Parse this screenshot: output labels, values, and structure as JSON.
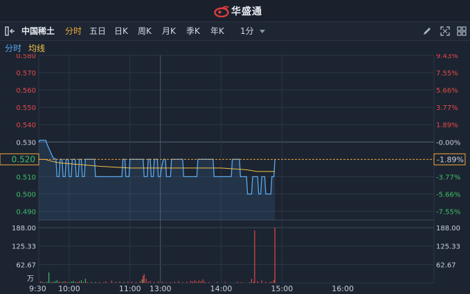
{
  "app": {
    "brand_name": "华盛通"
  },
  "toolbar": {
    "stock_name": "中国稀土",
    "tabs": [
      {
        "label": "分时",
        "active": true
      },
      {
        "label": "五日",
        "active": false
      },
      {
        "label": "日K",
        "active": false
      },
      {
        "label": "周K",
        "active": false
      },
      {
        "label": "月K",
        "active": false
      },
      {
        "label": "季K",
        "active": false
      },
      {
        "label": "年K",
        "active": false
      }
    ],
    "interval": "1分",
    "icons": [
      "collapse-icon",
      "pencil-icon",
      "fullscreen-icon",
      "grid-icon"
    ]
  },
  "legend": {
    "price_label": "分时",
    "avg_label": "均线"
  },
  "colors": {
    "background": "#1c2431",
    "grid": "#2c3646",
    "up": "#e54848",
    "down": "#3fbf6a",
    "price_line": "#5aa9f0",
    "avg_line": "#f2c44a",
    "neutral": "#c9d1dc"
  },
  "chart_data": {
    "type": "line",
    "prev_close": 0.53,
    "current_price_label": "0.520",
    "current_pct_label": "-1.89%",
    "price_ylim": [
      0.485,
      0.58
    ],
    "price_ticks_left": [
      "0.580",
      "0.570",
      "0.560",
      "0.550",
      "0.540",
      "0.530",
      "0.510",
      "0.500",
      "0.490"
    ],
    "price_ticks_right": [
      "9.43%",
      "7.55%",
      "5.66%",
      "3.77%",
      "1.89%",
      "-0.00%",
      "-3.77%",
      "-5.66%",
      "-7.55%"
    ],
    "volume_ylim": [
      0,
      188
    ],
    "volume_ticks_left": [
      "188.00",
      "125.33",
      "62.67"
    ],
    "volume_ticks_right": [
      "188.00",
      "125.33",
      "62.67"
    ],
    "volume_unit": "万",
    "time_labels": [
      "9:30",
      "10:00",
      "11:00",
      "13:00",
      "14:00",
      "15:00",
      "16:00"
    ],
    "session_minutes": 390,
    "price_series": [
      [
        0,
        0.53
      ],
      [
        1,
        0.531
      ],
      [
        7,
        0.531
      ],
      [
        8,
        0.529
      ],
      [
        14,
        0.521
      ],
      [
        17,
        0.52
      ],
      [
        18,
        0.51
      ],
      [
        20,
        0.51
      ],
      [
        21,
        0.52
      ],
      [
        23,
        0.52
      ],
      [
        24,
        0.51
      ],
      [
        26,
        0.51
      ],
      [
        27,
        0.52
      ],
      [
        29,
        0.52
      ],
      [
        30,
        0.51
      ],
      [
        32,
        0.51
      ],
      [
        33,
        0.52
      ],
      [
        36,
        0.52
      ],
      [
        37,
        0.51
      ],
      [
        39,
        0.51
      ],
      [
        40,
        0.52
      ],
      [
        42,
        0.52
      ],
      [
        43,
        0.51
      ],
      [
        45,
        0.51
      ],
      [
        46,
        0.52
      ],
      [
        55,
        0.52
      ],
      [
        56,
        0.51
      ],
      [
        82,
        0.51
      ],
      [
        83,
        0.52
      ],
      [
        85,
        0.52
      ],
      [
        86,
        0.51
      ],
      [
        89,
        0.51
      ],
      [
        90,
        0.52
      ],
      [
        103,
        0.52
      ],
      [
        104,
        0.51
      ],
      [
        107,
        0.51
      ],
      [
        108,
        0.52
      ],
      [
        110,
        0.52
      ],
      [
        111,
        0.51
      ],
      [
        113,
        0.51
      ],
      [
        114,
        0.52
      ],
      [
        117,
        0.52
      ],
      [
        118,
        0.51
      ],
      [
        120,
        0.51
      ],
      [
        121,
        0.515
      ],
      [
        123,
        0.52
      ],
      [
        125,
        0.52
      ],
      [
        126,
        0.51
      ],
      [
        130,
        0.51
      ],
      [
        131,
        0.52
      ],
      [
        142,
        0.52
      ],
      [
        143,
        0.51
      ],
      [
        156,
        0.51
      ],
      [
        157,
        0.52
      ],
      [
        172,
        0.52
      ],
      [
        173,
        0.51
      ],
      [
        190,
        0.51
      ],
      [
        191,
        0.52
      ],
      [
        198,
        0.52
      ],
      [
        199,
        0.51
      ],
      [
        205,
        0.51
      ],
      [
        206,
        0.5
      ],
      [
        210,
        0.5
      ],
      [
        211,
        0.51
      ],
      [
        216,
        0.51
      ],
      [
        217,
        0.5
      ],
      [
        219,
        0.5
      ],
      [
        220,
        0.51
      ],
      [
        223,
        0.51
      ],
      [
        224,
        0.5
      ],
      [
        229,
        0.5
      ],
      [
        230,
        0.51
      ],
      [
        232,
        0.51
      ],
      [
        233,
        0.52
      ]
    ],
    "avg_series": [
      [
        0,
        0.52
      ],
      [
        6,
        0.52
      ],
      [
        12,
        0.519
      ],
      [
        20,
        0.518
      ],
      [
        40,
        0.517
      ],
      [
        60,
        0.516
      ],
      [
        90,
        0.515
      ],
      [
        120,
        0.515
      ],
      [
        150,
        0.515
      ],
      [
        180,
        0.515
      ],
      [
        205,
        0.514
      ],
      [
        215,
        0.513
      ],
      [
        225,
        0.513
      ],
      [
        233,
        0.513
      ]
    ],
    "volume_series": [
      {
        "t": 2,
        "v": 6,
        "dir": "up"
      },
      {
        "t": 4,
        "v": 3,
        "dir": "down"
      },
      {
        "t": 6,
        "v": 2,
        "dir": "up"
      },
      {
        "t": 8,
        "v": 4,
        "dir": "down"
      },
      {
        "t": 10,
        "v": 36,
        "dir": "down"
      },
      {
        "t": 12,
        "v": 3,
        "dir": "down"
      },
      {
        "t": 14,
        "v": 4,
        "dir": "up"
      },
      {
        "t": 16,
        "v": 6,
        "dir": "down"
      },
      {
        "t": 18,
        "v": 9,
        "dir": "down"
      },
      {
        "t": 20,
        "v": 5,
        "dir": "up"
      },
      {
        "t": 22,
        "v": 3,
        "dir": "up"
      },
      {
        "t": 24,
        "v": 4,
        "dir": "down"
      },
      {
        "t": 26,
        "v": 6,
        "dir": "up"
      },
      {
        "t": 28,
        "v": 3,
        "dir": "up"
      },
      {
        "t": 30,
        "v": 2,
        "dir": "down"
      },
      {
        "t": 32,
        "v": 5,
        "dir": "down"
      },
      {
        "t": 34,
        "v": 7,
        "dir": "down"
      },
      {
        "t": 36,
        "v": 4,
        "dir": "up"
      },
      {
        "t": 38,
        "v": 3,
        "dir": "down"
      },
      {
        "t": 40,
        "v": 6,
        "dir": "up"
      },
      {
        "t": 42,
        "v": 9,
        "dir": "down"
      },
      {
        "t": 44,
        "v": 4,
        "dir": "up"
      },
      {
        "t": 46,
        "v": 14,
        "dir": "down"
      },
      {
        "t": 48,
        "v": 3,
        "dir": "up"
      },
      {
        "t": 52,
        "v": 4,
        "dir": "up"
      },
      {
        "t": 56,
        "v": 3,
        "dir": "down"
      },
      {
        "t": 60,
        "v": 3,
        "dir": "up"
      },
      {
        "t": 64,
        "v": 2,
        "dir": "up"
      },
      {
        "t": 66,
        "v": 5,
        "dir": "up"
      },
      {
        "t": 72,
        "v": 8,
        "dir": "up"
      },
      {
        "t": 76,
        "v": 4,
        "dir": "up"
      },
      {
        "t": 80,
        "v": 5,
        "dir": "up"
      },
      {
        "t": 84,
        "v": 3,
        "dir": "down"
      },
      {
        "t": 88,
        "v": 5,
        "dir": "up"
      },
      {
        "t": 92,
        "v": 4,
        "dir": "up"
      },
      {
        "t": 96,
        "v": 3,
        "dir": "up"
      },
      {
        "t": 100,
        "v": 6,
        "dir": "up"
      },
      {
        "t": 102,
        "v": 12,
        "dir": "down"
      },
      {
        "t": 103,
        "v": 24,
        "dir": "up"
      },
      {
        "t": 104,
        "v": 30,
        "dir": "up"
      },
      {
        "t": 106,
        "v": 14,
        "dir": "up"
      },
      {
        "t": 108,
        "v": 4,
        "dir": "up"
      },
      {
        "t": 110,
        "v": 6,
        "dir": "up"
      },
      {
        "t": 114,
        "v": 3,
        "dir": "up"
      },
      {
        "t": 118,
        "v": 5,
        "dir": "up"
      },
      {
        "t": 122,
        "v": 4,
        "dir": "up"
      },
      {
        "t": 126,
        "v": 2,
        "dir": "up"
      },
      {
        "t": 130,
        "v": 3,
        "dir": "up"
      },
      {
        "t": 134,
        "v": 4,
        "dir": "up"
      },
      {
        "t": 138,
        "v": 6,
        "dir": "up"
      },
      {
        "t": 142,
        "v": 3,
        "dir": "up"
      },
      {
        "t": 146,
        "v": 4,
        "dir": "up"
      },
      {
        "t": 150,
        "v": 7,
        "dir": "up"
      },
      {
        "t": 152,
        "v": 5,
        "dir": "up"
      },
      {
        "t": 154,
        "v": 9,
        "dir": "up"
      },
      {
        "t": 156,
        "v": 4,
        "dir": "up"
      },
      {
        "t": 158,
        "v": 8,
        "dir": "up"
      },
      {
        "t": 160,
        "v": 6,
        "dir": "up"
      },
      {
        "t": 162,
        "v": 12,
        "dir": "up"
      },
      {
        "t": 164,
        "v": 4,
        "dir": "up"
      },
      {
        "t": 168,
        "v": 3,
        "dir": "up"
      },
      {
        "t": 176,
        "v": 4,
        "dir": "up"
      },
      {
        "t": 184,
        "v": 3,
        "dir": "up"
      },
      {
        "t": 196,
        "v": 4,
        "dir": "up"
      },
      {
        "t": 200,
        "v": 3,
        "dir": "up"
      },
      {
        "t": 208,
        "v": 2,
        "dir": "down"
      },
      {
        "t": 210,
        "v": 14,
        "dir": "up"
      },
      {
        "t": 212,
        "v": 4,
        "dir": "up"
      },
      {
        "t": 213,
        "v": 178,
        "dir": "up"
      },
      {
        "t": 216,
        "v": 6,
        "dir": "up"
      },
      {
        "t": 220,
        "v": 9,
        "dir": "up"
      },
      {
        "t": 224,
        "v": 4,
        "dir": "up"
      },
      {
        "t": 228,
        "v": 3,
        "dir": "up"
      },
      {
        "t": 230,
        "v": 5,
        "dir": "up"
      },
      {
        "t": 232,
        "v": 10,
        "dir": "up"
      },
      {
        "t": 233,
        "v": 188,
        "dir": "up"
      }
    ]
  }
}
